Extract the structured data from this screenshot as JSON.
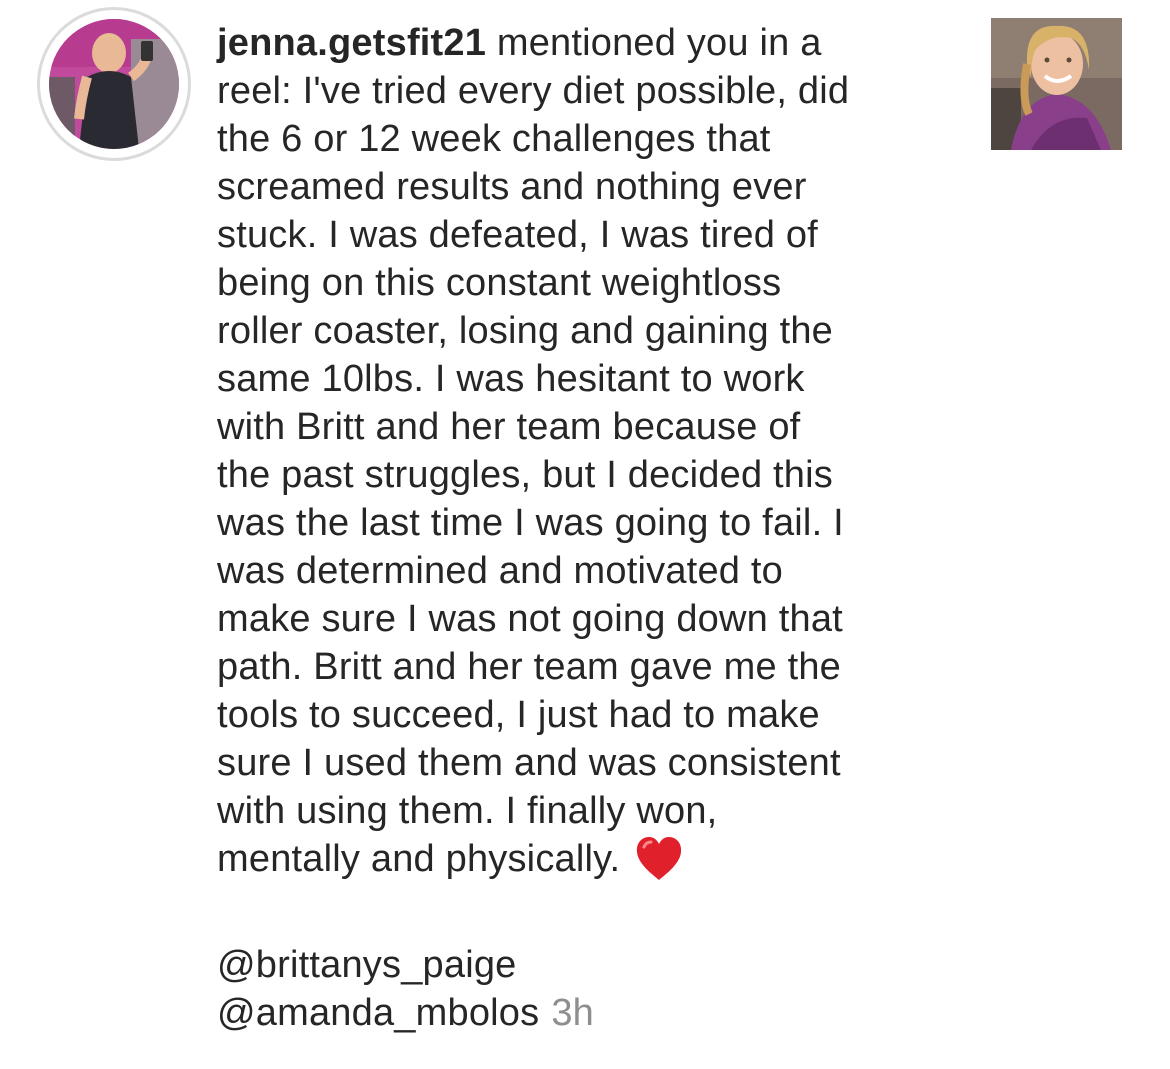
{
  "notification": {
    "username": "jenna.getsfit21",
    "lines": [
      " mentioned you in a",
      "reel: I've tried every diet possible, did",
      "the 6 or 12 week challenges that",
      "screamed results and nothing ever",
      "stuck. I was defeated, I was tired of",
      "being on this constant weightloss",
      "roller coaster, losing and gaining the",
      "same 10lbs. I was hesitant to work",
      "with Britt and her team because of",
      "the past struggles, but I decided this",
      "was the last time I was going to fail. I",
      "was determined and motivated to",
      "make sure I was not going down that",
      "path. Britt and her team gave me the",
      "tools to succeed, I just had to make",
      "sure I used them and was consistent",
      "with using them. I finally won,",
      "mentally and physically."
    ],
    "emoji": "red-heart",
    "mentions": [
      "@brittanys_paige",
      "@amanda_mbolos"
    ],
    "timestamp": "3h",
    "colors": {
      "text": "#262626",
      "timestamp": "#8e8e8e",
      "avatar_ring": "#dbdbdb",
      "heart": "#e0202a"
    },
    "avatar_icon": "profile-photo",
    "thumbnail_icon": "reel-thumbnail"
  }
}
